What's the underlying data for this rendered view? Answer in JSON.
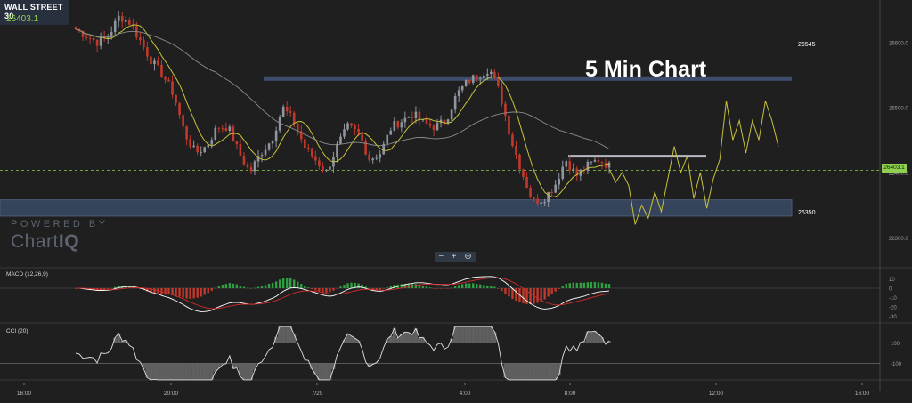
{
  "ticker": {
    "name": "WALL STREET 30",
    "price": "26403.1"
  },
  "annotation_title": "5 Min Chart",
  "watermark": {
    "line1": "POWERED BY",
    "line2a": "Chart",
    "line2b": "IQ"
  },
  "zoom_controls": [
    "−",
    "+",
    "⊕"
  ],
  "indicators": {
    "macd": "MACD (12,26,9)",
    "cci": "CCI (20)"
  },
  "colors": {
    "background": "#1f1f1f",
    "bull": "#8f959e",
    "bear": "#c0392b",
    "ma_fast": "#c9c23a",
    "ma_slow": "#8c8c8c",
    "zone": "#3e5170",
    "current_price": "#8fd14f",
    "macd_line": "#ffffff",
    "signal_line": "#d42b2b",
    "hist_pos": "#2ea043",
    "hist_neg": "#c0392b"
  },
  "chart_data": {
    "type": "candlestick",
    "title": "5 Min Chart",
    "instrument": "WALL STREET 30",
    "price_axis_ticks": [
      26600,
      26500,
      26400,
      26300
    ],
    "price_range": [
      26255,
      26665
    ],
    "time_labels": [
      "16:00",
      "20:00",
      "7/29",
      "4:00",
      "8:00",
      "12:00",
      "16:00"
    ],
    "current_price": 26403.1,
    "levels": [
      {
        "label": "26545",
        "value": 26545,
        "kind": "resistance"
      },
      {
        "label": "26350",
        "value": 26350,
        "kind": "support-zone",
        "range": [
          26333,
          26358
        ]
      }
    ],
    "local_resistance": 26425,
    "close_path": [
      26620,
      26610,
      26600,
      26610,
      26640,
      26630,
      26600,
      26570,
      26550,
      26520,
      26460,
      26430,
      26440,
      26470,
      26470,
      26430,
      26400,
      26430,
      26450,
      26500,
      26480,
      26440,
      26420,
      26400,
      26440,
      26470,
      26460,
      26420,
      26430,
      26470,
      26480,
      26490,
      26475,
      26470,
      26480,
      26520,
      26540,
      26550,
      26560,
      26520,
      26450,
      26400,
      26355,
      26360,
      26380,
      26420,
      26395,
      26410,
      26420,
      26410
    ],
    "projection_path": [
      26405,
      26385,
      26400,
      26380,
      26320,
      26350,
      26330,
      26370,
      26340,
      26390,
      26440,
      26400,
      26425,
      26360,
      26400,
      26345,
      26390,
      26420,
      26510,
      26450,
      26480,
      26430,
      26480,
      26450,
      26510,
      26480,
      26440
    ],
    "macd": {
      "ticks": [
        10,
        0,
        -10,
        -20,
        -30
      ]
    },
    "cci": {
      "ticks": [
        100,
        -100
      ]
    }
  }
}
